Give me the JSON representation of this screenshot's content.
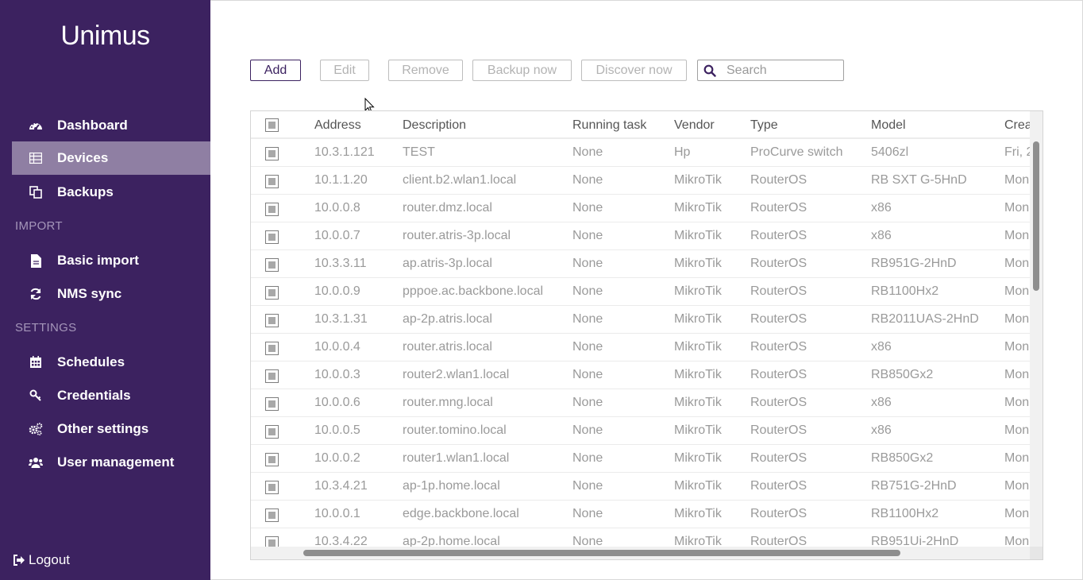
{
  "app": {
    "logo": "Unimus"
  },
  "sidebar": {
    "items": [
      {
        "label": "Dashboard",
        "icon": "dashboard-icon"
      },
      {
        "label": "Devices",
        "icon": "table-icon",
        "active": true
      },
      {
        "label": "Backups",
        "icon": "copy-icon"
      },
      {
        "label": "Basic import",
        "icon": "file-icon"
      },
      {
        "label": "NMS sync",
        "icon": "sync-icon"
      },
      {
        "label": "Schedules",
        "icon": "calendar-icon"
      },
      {
        "label": "Credentials",
        "icon": "key-icon"
      },
      {
        "label": "Other settings",
        "icon": "gears-icon"
      },
      {
        "label": "User management",
        "icon": "users-icon"
      }
    ],
    "sections": {
      "import": "IMPORT",
      "settings": "SETTINGS"
    },
    "logout": "Logout"
  },
  "toolbar": {
    "add": "Add",
    "edit": "Edit",
    "remove": "Remove",
    "backup_now": "Backup now",
    "discover_now": "Discover now",
    "search_placeholder": "Search"
  },
  "table": {
    "columns": [
      "Address",
      "Description",
      "Running task",
      "Vendor",
      "Type",
      "Model",
      "Crea"
    ],
    "rows": [
      [
        "10.3.1.121",
        "TEST",
        "None",
        "Hp",
        "ProCurve switch",
        "5406zl",
        "Fri, 2"
      ],
      [
        "10.1.1.20",
        "client.b2.wlan1.local",
        "None",
        "MikroTik",
        "RouterOS",
        "RB SXT G-5HnD",
        "Mon"
      ],
      [
        "10.0.0.8",
        "router.dmz.local",
        "None",
        "MikroTik",
        "RouterOS",
        "x86",
        "Mon"
      ],
      [
        "10.0.0.7",
        "router.atris-3p.local",
        "None",
        "MikroTik",
        "RouterOS",
        "x86",
        "Mon"
      ],
      [
        "10.3.3.11",
        "ap.atris-3p.local",
        "None",
        "MikroTik",
        "RouterOS",
        "RB951G-2HnD",
        "Mon"
      ],
      [
        "10.0.0.9",
        "pppoe.ac.backbone.local",
        "None",
        "MikroTik",
        "RouterOS",
        "RB1100Hx2",
        "Mon"
      ],
      [
        "10.3.1.31",
        "ap-2p.atris.local",
        "None",
        "MikroTik",
        "RouterOS",
        "RB2011UAS-2HnD",
        "Mon"
      ],
      [
        "10.0.0.4",
        "router.atris.local",
        "None",
        "MikroTik",
        "RouterOS",
        "x86",
        "Mon"
      ],
      [
        "10.0.0.3",
        "router2.wlan1.local",
        "None",
        "MikroTik",
        "RouterOS",
        "RB850Gx2",
        "Mon"
      ],
      [
        "10.0.0.6",
        "router.mng.local",
        "None",
        "MikroTik",
        "RouterOS",
        "x86",
        "Mon"
      ],
      [
        "10.0.0.5",
        "router.tomino.local",
        "None",
        "MikroTik",
        "RouterOS",
        "x86",
        "Mon"
      ],
      [
        "10.0.0.2",
        "router1.wlan1.local",
        "None",
        "MikroTik",
        "RouterOS",
        "RB850Gx2",
        "Mon"
      ],
      [
        "10.3.4.21",
        "ap-1p.home.local",
        "None",
        "MikroTik",
        "RouterOS",
        "RB751G-2HnD",
        "Mon"
      ],
      [
        "10.0.0.1",
        "edge.backbone.local",
        "None",
        "MikroTik",
        "RouterOS",
        "RB1100Hx2",
        "Mon"
      ],
      [
        "10.3.4.22",
        "ap-2p.home.local",
        "None",
        "MikroTik",
        "RouterOS",
        "RB951Ui-2HnD",
        "Mon"
      ]
    ]
  },
  "colors": {
    "sidebar_bg": "#3c2260",
    "active_item": "#8f7fa3",
    "section_text": "#a596ba"
  }
}
